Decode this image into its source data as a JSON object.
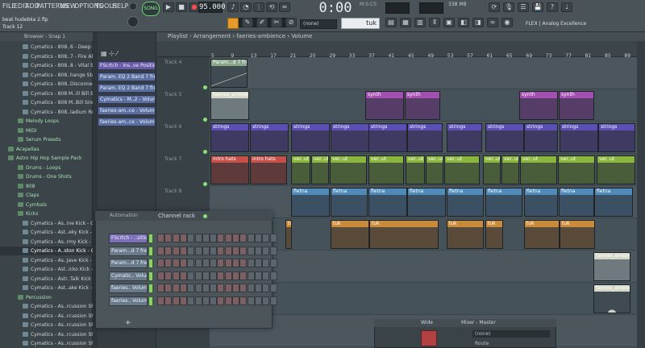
{
  "menu": [
    "FILE",
    "EDIT",
    "ADD",
    "PATTERNS",
    "VIEW",
    "OPTIONS",
    "TOOLS",
    "HELP"
  ],
  "transport": {
    "song_mode": "SONG",
    "tempo": "95.000",
    "time": "0:00",
    "time_small": "M:S:CS",
    "pattern_select": "(none)",
    "tool_input": "tuk",
    "cpu": "338 MB"
  },
  "hint": {
    "file": "beat hudebka 2.flp",
    "track": "Track 12"
  },
  "plugin_bar": "FLEX | Analog Excellence",
  "browser": {
    "header": "Browser - Snap 1",
    "items": [
      {
        "text": "Cymatics - 808..6 - Deep Glass",
        "kind": "file"
      },
      {
        "text": "Cymatics - 808..7 - Fire Alarm",
        "kind": "file"
      },
      {
        "text": "Cymatics - 808..8 - Vital Signs",
        "kind": "file"
      },
      {
        "text": "Cymatics - 808..hange Station",
        "kind": "file"
      },
      {
        "text": "Cymatics - 808..Disconnected",
        "kind": "file"
      },
      {
        "text": "Cymatics - 808 M..ill Bill Siren",
        "kind": "file"
      },
      {
        "text": "Cymatics - 808 M..Bill Siren 2",
        "kind": "file"
      },
      {
        "text": "Cymatics - 808..ladium Rodeo",
        "kind": "file"
      },
      {
        "text": "Melody Loops",
        "kind": "folder"
      },
      {
        "text": "MIDI",
        "kind": "folder"
      },
      {
        "text": "Serum Presets",
        "kind": "folder"
      },
      {
        "text": "Acapellas",
        "kind": "folder"
      },
      {
        "text": "Astro Hip Hop Sample Pack",
        "kind": "folder"
      },
      {
        "text": "Drums - Loops",
        "kind": "folder"
      },
      {
        "text": "Drums - One Shots",
        "kind": "folder"
      },
      {
        "text": "808",
        "kind": "folder"
      },
      {
        "text": "Claps",
        "kind": "folder"
      },
      {
        "text": "Cymbals",
        "kind": "folder"
      },
      {
        "text": "Kicks",
        "kind": "folder"
      },
      {
        "text": "Cymatics - As..ine Kick - G#",
        "kind": "file"
      },
      {
        "text": "Cymatics - Ast..eky Kick - F#",
        "kind": "file"
      },
      {
        "text": "Cymatics - As..rmy Kick - F#",
        "kind": "file"
      },
      {
        "text": "Cymatics - A..ston Kick - G",
        "kind": "sel"
      },
      {
        "text": "Cymatics - As..Jave Kick - F#",
        "kind": "file"
      },
      {
        "text": "Cymatics - Ast..icko Kick - D",
        "kind": "file"
      },
      {
        "text": "Cymatics - Astr..Talk Kick - G",
        "kind": "file"
      },
      {
        "text": "Cymatics - Ast..ake Kick - C",
        "kind": "file"
      },
      {
        "text": "Percussion",
        "kind": "folder"
      },
      {
        "text": "Cymatics - As..rcussion Shot",
        "kind": "file"
      },
      {
        "text": "Cymatics - As..rcussion Shot",
        "kind": "file"
      },
      {
        "text": "Cymatics - As..rcussion Shot",
        "kind": "file"
      },
      {
        "text": "Cymatics - As..rcussion Shot",
        "kind": "file"
      },
      {
        "text": "Cymatics - As..rcussion Shot",
        "kind": "file"
      }
    ]
  },
  "clips_panel": [
    "FScrtch - Ins..ve Position",
    "Param. EQ 2 Band 7 freq",
    "Param. EQ 2 Band 7 freq",
    "Cymatics - M..2 - Volume",
    "faeries-am..ce - Volume",
    "faeries-am..ce - Volume"
  ],
  "playlist": {
    "title": "Playlist - Arrangement › faeries-ambience › Volume",
    "ruler": [
      "5",
      "9",
      "13",
      "17",
      "21",
      "25",
      "29",
      "33",
      "37",
      "41",
      "45",
      "49",
      "53",
      "57",
      "61",
      "65",
      "69",
      "73",
      "77",
      "81",
      "85",
      "89"
    ],
    "tracks": [
      "Track 4",
      "Track 5",
      "Track 6",
      "Track 7",
      "Track 8"
    ],
    "clip_labels": {
      "param": "Param...d 7 freq",
      "faeries": "faeries_ambience",
      "synth": "synth",
      "strings": "strings",
      "intro_hats": "intro hats",
      "verb": "ver..ut",
      "fletna": "fletna",
      "tuk": "tuk"
    }
  },
  "channel_rack": {
    "title": "Channel rack",
    "mode": "Automation",
    "channels": [
      "FScrtch - ..sition",
      "Param...d 7 freq",
      "Param...d 7 freq",
      "Cymatic.. Volume",
      "faeries.. Volume",
      "faeries.. Volume"
    ]
  },
  "mixer": {
    "title": "Mixer - Master",
    "label": "Wide",
    "slot": "(none)",
    "route": "Route"
  },
  "colors": {
    "synth": "#a24fb0",
    "strings": "#5a4fb5",
    "intro_hats": "#c5504a",
    "verb": "#8ab53f",
    "fletna": "#4f8ab8",
    "tuk": "#c98a3b",
    "faeries": "#d5d8c8"
  }
}
